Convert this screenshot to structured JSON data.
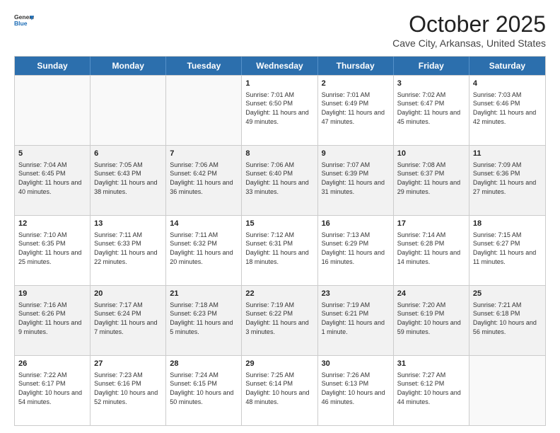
{
  "header": {
    "logo_line1": "General",
    "logo_line2": "Blue",
    "month": "October 2025",
    "location": "Cave City, Arkansas, United States"
  },
  "days_of_week": [
    "Sunday",
    "Monday",
    "Tuesday",
    "Wednesday",
    "Thursday",
    "Friday",
    "Saturday"
  ],
  "weeks": [
    [
      {
        "day": "",
        "info": ""
      },
      {
        "day": "",
        "info": ""
      },
      {
        "day": "",
        "info": ""
      },
      {
        "day": "1",
        "info": "Sunrise: 7:01 AM\nSunset: 6:50 PM\nDaylight: 11 hours\nand 49 minutes."
      },
      {
        "day": "2",
        "info": "Sunrise: 7:01 AM\nSunset: 6:49 PM\nDaylight: 11 hours\nand 47 minutes."
      },
      {
        "day": "3",
        "info": "Sunrise: 7:02 AM\nSunset: 6:47 PM\nDaylight: 11 hours\nand 45 minutes."
      },
      {
        "day": "4",
        "info": "Sunrise: 7:03 AM\nSunset: 6:46 PM\nDaylight: 11 hours\nand 42 minutes."
      }
    ],
    [
      {
        "day": "5",
        "info": "Sunrise: 7:04 AM\nSunset: 6:45 PM\nDaylight: 11 hours\nand 40 minutes."
      },
      {
        "day": "6",
        "info": "Sunrise: 7:05 AM\nSunset: 6:43 PM\nDaylight: 11 hours\nand 38 minutes."
      },
      {
        "day": "7",
        "info": "Sunrise: 7:06 AM\nSunset: 6:42 PM\nDaylight: 11 hours\nand 36 minutes."
      },
      {
        "day": "8",
        "info": "Sunrise: 7:06 AM\nSunset: 6:40 PM\nDaylight: 11 hours\nand 33 minutes."
      },
      {
        "day": "9",
        "info": "Sunrise: 7:07 AM\nSunset: 6:39 PM\nDaylight: 11 hours\nand 31 minutes."
      },
      {
        "day": "10",
        "info": "Sunrise: 7:08 AM\nSunset: 6:37 PM\nDaylight: 11 hours\nand 29 minutes."
      },
      {
        "day": "11",
        "info": "Sunrise: 7:09 AM\nSunset: 6:36 PM\nDaylight: 11 hours\nand 27 minutes."
      }
    ],
    [
      {
        "day": "12",
        "info": "Sunrise: 7:10 AM\nSunset: 6:35 PM\nDaylight: 11 hours\nand 25 minutes."
      },
      {
        "day": "13",
        "info": "Sunrise: 7:11 AM\nSunset: 6:33 PM\nDaylight: 11 hours\nand 22 minutes."
      },
      {
        "day": "14",
        "info": "Sunrise: 7:11 AM\nSunset: 6:32 PM\nDaylight: 11 hours\nand 20 minutes."
      },
      {
        "day": "15",
        "info": "Sunrise: 7:12 AM\nSunset: 6:31 PM\nDaylight: 11 hours\nand 18 minutes."
      },
      {
        "day": "16",
        "info": "Sunrise: 7:13 AM\nSunset: 6:29 PM\nDaylight: 11 hours\nand 16 minutes."
      },
      {
        "day": "17",
        "info": "Sunrise: 7:14 AM\nSunset: 6:28 PM\nDaylight: 11 hours\nand 14 minutes."
      },
      {
        "day": "18",
        "info": "Sunrise: 7:15 AM\nSunset: 6:27 PM\nDaylight: 11 hours\nand 11 minutes."
      }
    ],
    [
      {
        "day": "19",
        "info": "Sunrise: 7:16 AM\nSunset: 6:26 PM\nDaylight: 11 hours\nand 9 minutes."
      },
      {
        "day": "20",
        "info": "Sunrise: 7:17 AM\nSunset: 6:24 PM\nDaylight: 11 hours\nand 7 minutes."
      },
      {
        "day": "21",
        "info": "Sunrise: 7:18 AM\nSunset: 6:23 PM\nDaylight: 11 hours\nand 5 minutes."
      },
      {
        "day": "22",
        "info": "Sunrise: 7:19 AM\nSunset: 6:22 PM\nDaylight: 11 hours\nand 3 minutes."
      },
      {
        "day": "23",
        "info": "Sunrise: 7:19 AM\nSunset: 6:21 PM\nDaylight: 11 hours\nand 1 minute."
      },
      {
        "day": "24",
        "info": "Sunrise: 7:20 AM\nSunset: 6:19 PM\nDaylight: 10 hours\nand 59 minutes."
      },
      {
        "day": "25",
        "info": "Sunrise: 7:21 AM\nSunset: 6:18 PM\nDaylight: 10 hours\nand 56 minutes."
      }
    ],
    [
      {
        "day": "26",
        "info": "Sunrise: 7:22 AM\nSunset: 6:17 PM\nDaylight: 10 hours\nand 54 minutes."
      },
      {
        "day": "27",
        "info": "Sunrise: 7:23 AM\nSunset: 6:16 PM\nDaylight: 10 hours\nand 52 minutes."
      },
      {
        "day": "28",
        "info": "Sunrise: 7:24 AM\nSunset: 6:15 PM\nDaylight: 10 hours\nand 50 minutes."
      },
      {
        "day": "29",
        "info": "Sunrise: 7:25 AM\nSunset: 6:14 PM\nDaylight: 10 hours\nand 48 minutes."
      },
      {
        "day": "30",
        "info": "Sunrise: 7:26 AM\nSunset: 6:13 PM\nDaylight: 10 hours\nand 46 minutes."
      },
      {
        "day": "31",
        "info": "Sunrise: 7:27 AM\nSunset: 6:12 PM\nDaylight: 10 hours\nand 44 minutes."
      },
      {
        "day": "",
        "info": ""
      }
    ]
  ]
}
